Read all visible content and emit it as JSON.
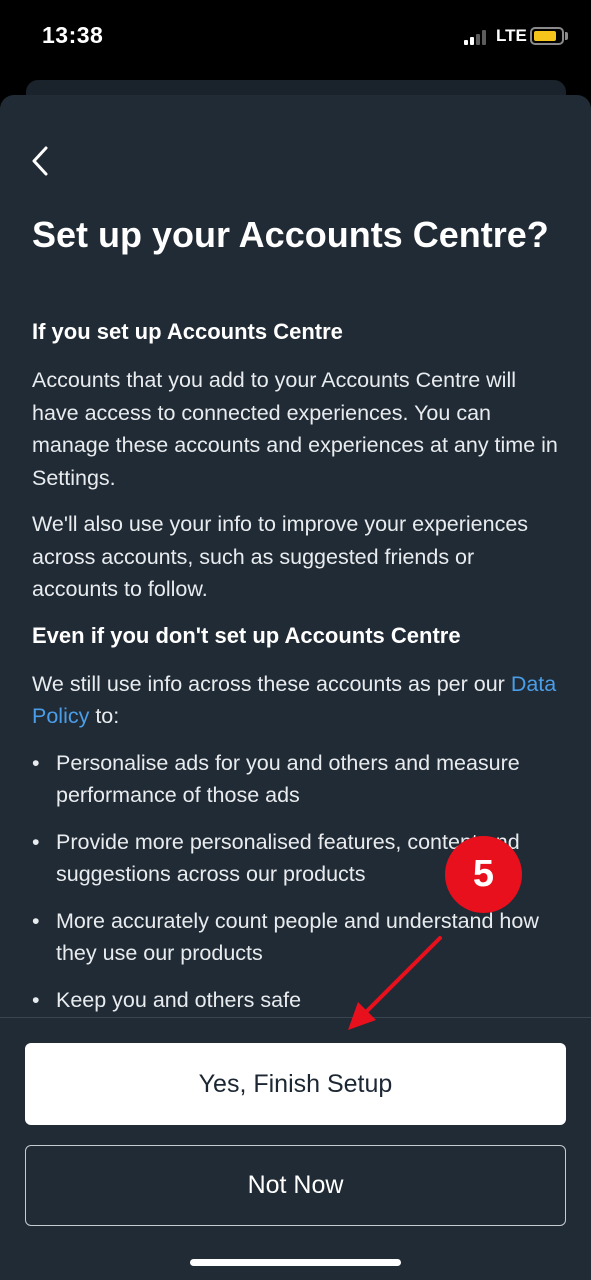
{
  "status": {
    "time": "13:38",
    "network": "LTE"
  },
  "title": "Set up your Accounts Centre?",
  "section1": {
    "heading": "If you set up Accounts Centre",
    "para1": "Accounts that you add to your Accounts Centre will have access to connected experiences. You can manage these accounts and experiences at any time in Settings.",
    "para2": "We'll also use your info to improve your experiences across accounts, such as suggested friends or accounts to follow."
  },
  "section2": {
    "heading": "Even if you don't set up Accounts Centre",
    "intro_before": "We still use info across these accounts as per our ",
    "link": "Data Policy",
    "intro_after": " to:",
    "bullets": [
      "Personalise ads for you and others and measure performance of those ads",
      "Provide more personalised features, content and suggestions across our products",
      "More accurately count people and understand how they use our products",
      "Keep you and others safe"
    ]
  },
  "buttons": {
    "primary": "Yes, Finish Setup",
    "secondary": "Not Now"
  },
  "annotation": {
    "step": "5",
    "color": "#e8101c"
  },
  "icons": {
    "back": "chevron-left-icon"
  },
  "colors": {
    "sheet_bg": "#212b35",
    "link": "#4a9de8",
    "primary_btn_bg": "#ffffff"
  }
}
